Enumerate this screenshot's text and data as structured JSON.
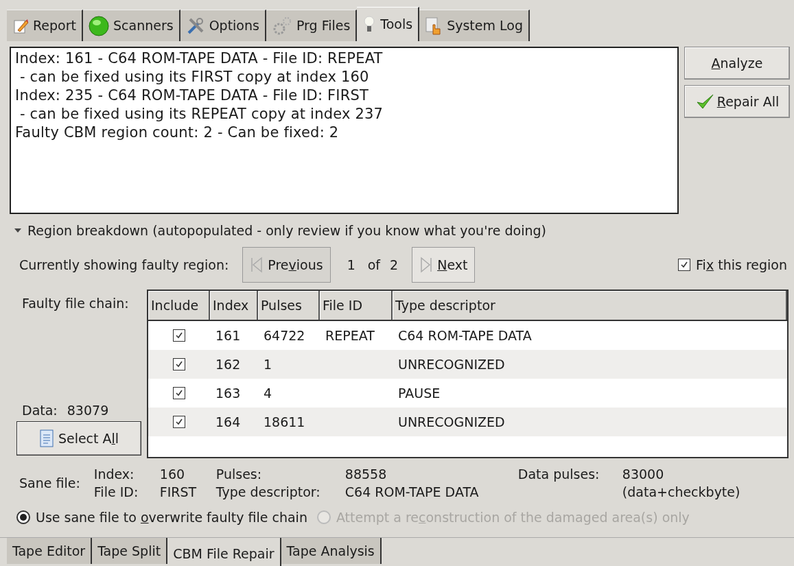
{
  "top_tabs": [
    {
      "label": "Report",
      "selected": false
    },
    {
      "label": "Scanners",
      "selected": false
    },
    {
      "label": "Options",
      "selected": false
    },
    {
      "label": "Prg Files",
      "selected": false
    },
    {
      "label": "Tools",
      "selected": true
    },
    {
      "label": "System Log",
      "selected": false
    }
  ],
  "log_lines": [
    "Index: 161 - C64 ROM-TAPE DATA - File ID: REPEAT",
    " - can be fixed using its FIRST copy at index 160",
    "Index: 235 - C64 ROM-TAPE DATA - File ID: FIRST",
    " - can be fixed using its REPEAT copy at index 237",
    "Faulty CBM region count: 2 - Can be fixed: 2"
  ],
  "side_buttons": [
    {
      "label_parts": {
        "key": "A",
        "after": "nalyze"
      }
    },
    {
      "label_parts": {
        "key": "R",
        "after": "epair All"
      }
    }
  ],
  "breakdown": {
    "label": "Region breakdown (autopopulated - only review if you know what you're doing)",
    "expanded": true
  },
  "nav": {
    "label": "Currently showing faulty region:",
    "previous": {
      "label_parts": {
        "before": "Pre",
        "key": "v",
        "after": "ious"
      },
      "disabled": true
    },
    "current": "1",
    "of": "of",
    "total": "2",
    "next": {
      "label_parts": {
        "key": "N",
        "after": "ext"
      },
      "disabled": false
    },
    "fix": {
      "label_parts": {
        "before": "Fi",
        "key": "x",
        "after": " this region"
      },
      "checked": true
    }
  },
  "chain_label": "Faulty file chain:",
  "data": {
    "label": "Data:",
    "value": "83079"
  },
  "select_all": {
    "label_parts": {
      "before": "Select A",
      "key": "l",
      "after": "l"
    }
  },
  "table": {
    "columns": [
      "Include",
      "Index",
      "Pulses",
      "File ID",
      "Type descriptor"
    ],
    "rows": [
      {
        "include": true,
        "index": "161",
        "pulses": "64722",
        "file_id": "REPEAT",
        "type": "C64 ROM-TAPE DATA"
      },
      {
        "include": true,
        "index": "162",
        "pulses": "1",
        "type": "UNRECOGNIZED"
      },
      {
        "include": true,
        "index": "163",
        "pulses": "4",
        "type": "PAUSE"
      },
      {
        "include": true,
        "index": "164",
        "pulses": "18611",
        "type": "UNRECOGNIZED"
      }
    ]
  },
  "sane": {
    "label": "Sane file:",
    "index_label": "Index:",
    "index": "160",
    "file_id_label": "File ID:",
    "file_id": "FIRST",
    "pulses_label": "Pulses:",
    "pulses": "88558",
    "type_label": "Type descriptor:",
    "type": "C64 ROM-TAPE DATA",
    "data_pulses_label": "Data pulses:",
    "data_pulses": "83000",
    "data_note": "(data+checkbyte)"
  },
  "modes": [
    {
      "label_parts": {
        "before": "Use sane file to ",
        "key": "o",
        "after": "verwrite faulty file chain"
      },
      "selected": true,
      "disabled": false
    },
    {
      "label_parts": {
        "before": "Attempt a re",
        "key": "c",
        "after": "onstruction of the damaged area(s) only"
      },
      "selected": false,
      "disabled": true
    }
  ],
  "bottom_tabs": [
    {
      "label": "Tape Editor",
      "selected": false
    },
    {
      "label": "Tape Split",
      "selected": false
    },
    {
      "label": "CBM File Repair",
      "selected": true
    },
    {
      "label": "Tape Analysis",
      "selected": false
    }
  ]
}
